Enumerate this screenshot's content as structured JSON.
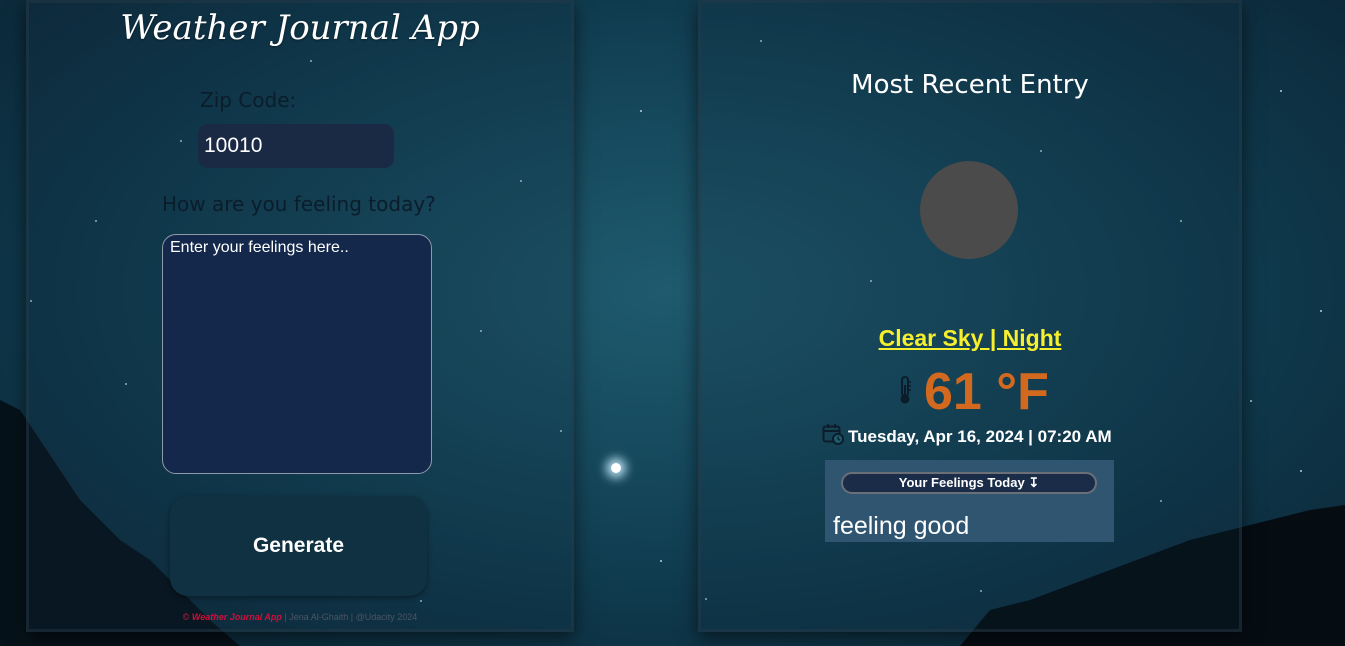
{
  "app": {
    "title": "Weather Journal App"
  },
  "form": {
    "zip_label": "Zip Code:",
    "zip_value": "10010",
    "feelings_label": "How are you feeling today?",
    "feelings_placeholder": "Enter your feelings here..",
    "generate_label": "Generate"
  },
  "footer": {
    "copyright_symbol": "©",
    "app_name": "Weather Journal App",
    "credits": "| Jena Al-Ghaith | @Udacity 2024"
  },
  "entry": {
    "title": "Most Recent Entry",
    "condition": "Clear Sky | Night",
    "temperature": "61 °F",
    "thermometer_icon": "thermometer-icon",
    "calendar_icon": "calendar-icon",
    "date": "Tuesday, Apr 16, 2024 | 07:20 AM",
    "feelings_header": "Your Feelings Today ↧",
    "feelings_content": "feeling good"
  },
  "colors": {
    "condition": "#f5ef2e",
    "temperature": "#d2691e",
    "footer_accent": "#d10f3b"
  }
}
